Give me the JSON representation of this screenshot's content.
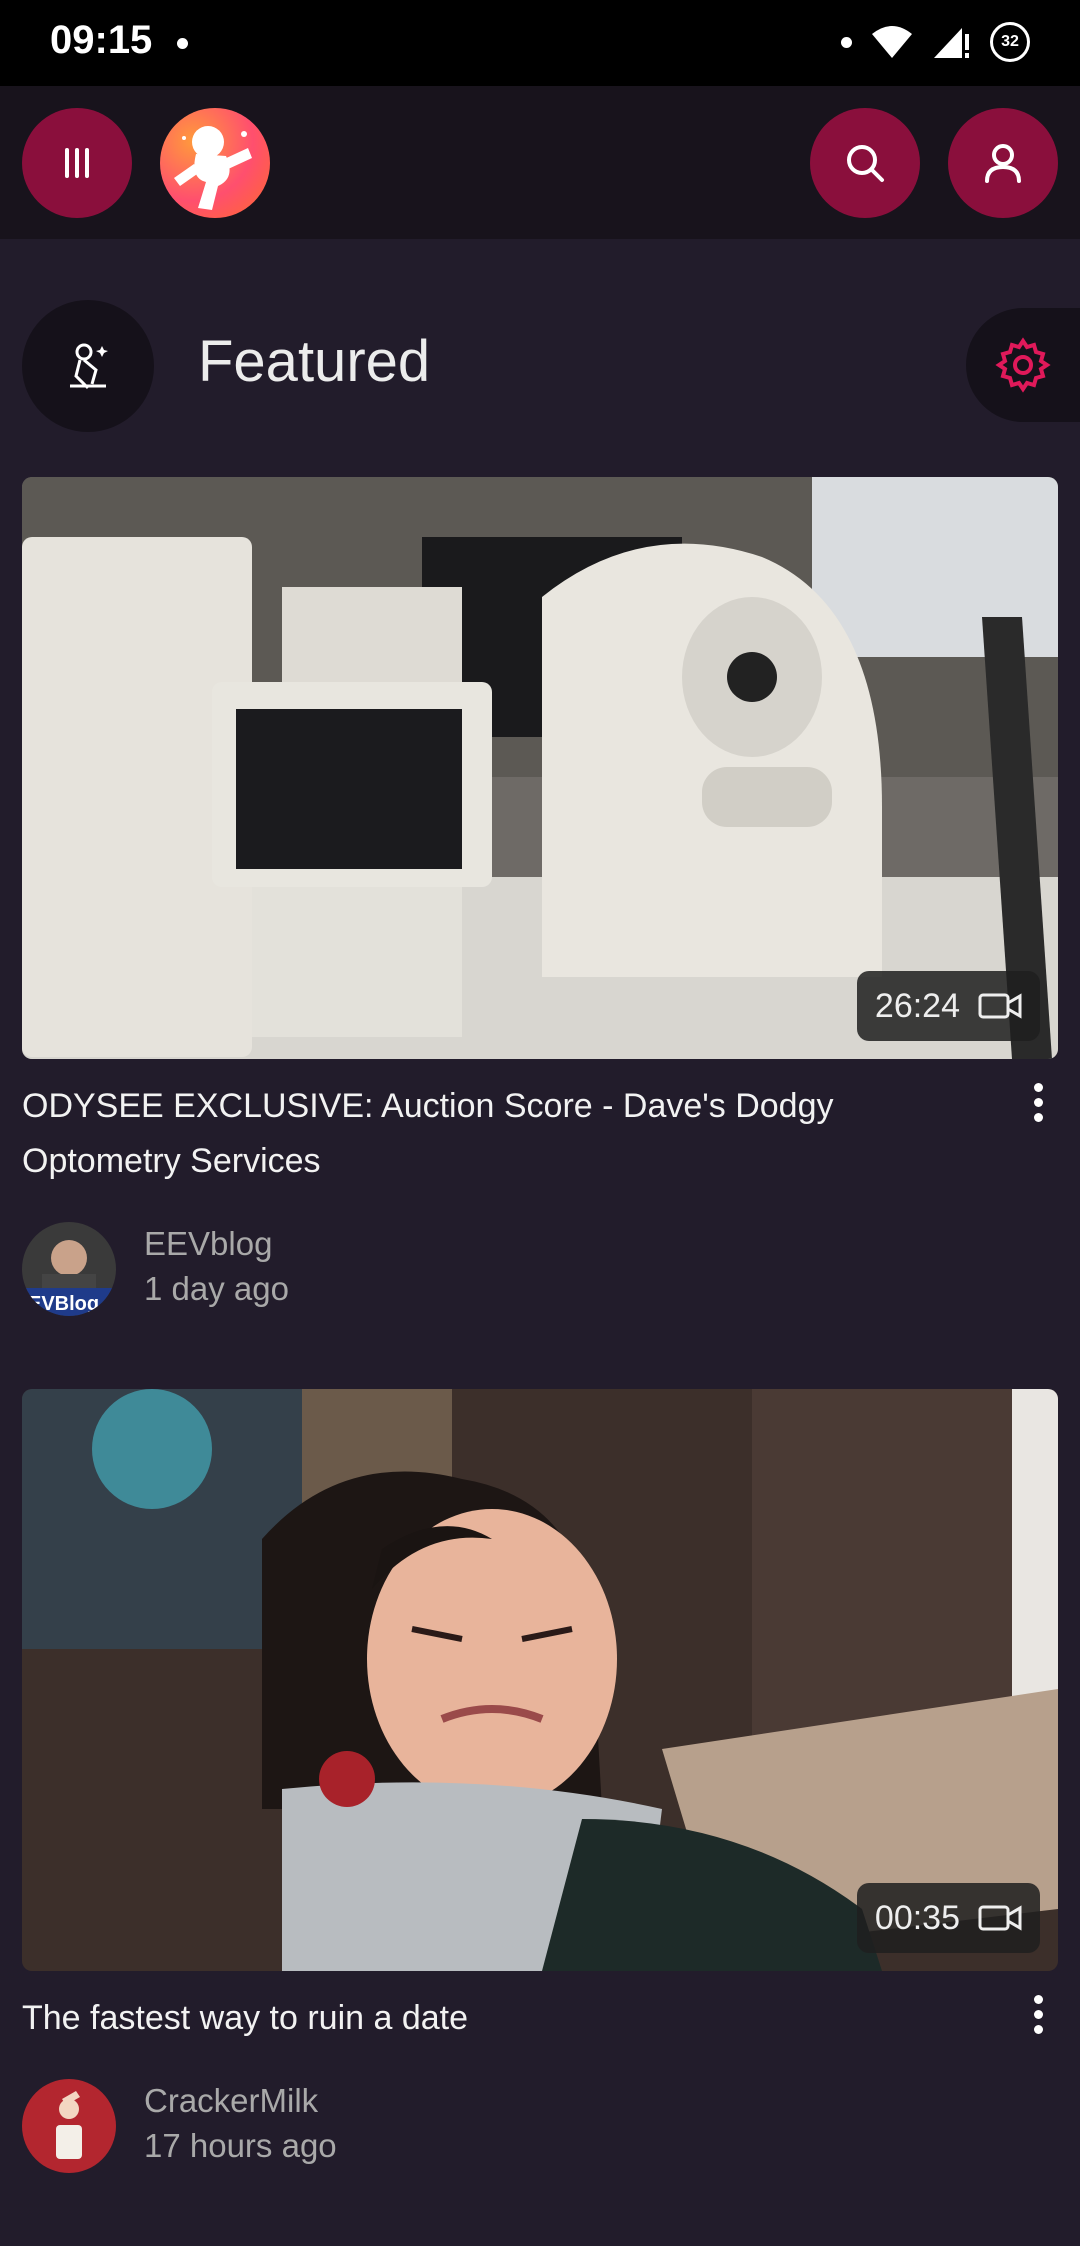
{
  "status_bar": {
    "time": "09:15",
    "battery_level": "32"
  },
  "app_bar": {
    "menu_icon": "menu-icon",
    "logo_icon": "spaceman-logo-icon",
    "search_icon": "search-icon",
    "account_icon": "user-icon"
  },
  "section": {
    "title": "Featured",
    "icon": "featured-spaceman-icon",
    "settings_icon": "gear-icon"
  },
  "videos": [
    {
      "title": "ODYSEE EXCLUSIVE: Auction Score - Dave's Dodgy Optometry Services",
      "duration": "26:24",
      "channel": "EEVblog",
      "age": "1 day ago"
    },
    {
      "title": "The fastest way to ruin a date",
      "duration": "00:35",
      "channel": "CrackerMilk",
      "age": "17 hours ago"
    }
  ],
  "colors": {
    "accent": "#8a0f3c",
    "gear": "#e0195a",
    "background": "#221c2b"
  }
}
